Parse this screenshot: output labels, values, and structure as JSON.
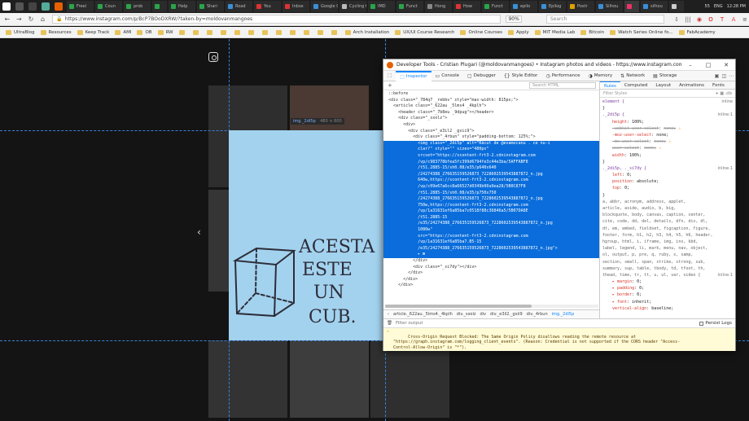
{
  "taskbar": {
    "tabs": [
      "Freel",
      "Coun",
      "prob",
      "",
      "Help",
      "Shari",
      "Road",
      "You",
      "Inbox",
      "Google C",
      "Cycling t",
      "IMD",
      "Funct",
      "Hong",
      "How",
      "Funct",
      "epilo",
      "Epilog",
      "Postr",
      "Silhou",
      "",
      "silhou",
      ""
    ],
    "tray": {
      "lang": "ENG",
      "time": "12:28 PM",
      "battery": "55"
    }
  },
  "browser": {
    "url": "https://www.instagram.com/p/BcP7BOoDXRW/?taken-by=moldovanmangoes",
    "zoom": "90%",
    "search_placeholder": "Search",
    "bookmarks": [
      "UltraBlog",
      "Resources",
      "Keep Track",
      "AMI",
      "OB",
      "RW",
      "",
      "",
      "",
      "",
      "",
      "",
      "",
      "",
      "",
      "",
      "",
      "",
      "Arch Installation",
      "UX/UI Course Research",
      "Online Courses",
      "Apply",
      "MIT Media Lab",
      "Bitcoin",
      "Watch Series Online fo...",
      "FabAcademy"
    ]
  },
  "page": {
    "image_tooltip": {
      "name": "img._2di5p",
      "size": "480 × 600"
    },
    "photo_text": [
      "ACESTA",
      "ESTE",
      "UN",
      "CUB."
    ]
  },
  "devtools": {
    "title": "Developer Tools - Cristian Plugari (@moldovanmangoes) • Instagram photos and videos - https://www.instagram.com/p/BcP7BOoDXR...",
    "tabs": [
      "Inspector",
      "Console",
      "Debugger",
      "Style Editor",
      "Performance",
      "Memory",
      "Network",
      "Storage"
    ],
    "search_html_placeholder": "Search HTML",
    "markup_lines": [
      "  ::before",
      "  <div class=\"_784q7 _rebbv\" style=\"max-width: 815px;\">",
      "    <article class=\"_622au _5lms4 _4kplh\">",
      "      <header class=\"_7b8eu _9dpug\"></header>",
      "      <div class=\"_sxolz\">",
      "        <div>",
      "          <div class=\"_e3il2 _gxii9\">",
      "            <div class=\"_4rbun\" style=\"padding-bottom: 125%;\">",
      "              <img class=\"_2di5p\" alt=\"Răcut de @evamocanu . ce nu-i",
      "              clar?\" style=\"\" sizes=\"480px\"",
      "              srcset=\"https://scontent-frt3-2.cdninstagram.com",
      "              /vp/c983778bfea5fc399d6794fe3c44e3ba/5AFFABF8",
      "              /t51.2885-15/sh0.08/e35/p640x640",
      "              /24274388_276635159526873_7228602539543887872_n.jpg",
      "              640w,https://scontent-frt3-2.cdninstagram.com",
      "              /vp/c09e67a6cc8a66527d0349b00a9ea28/5B0C87F8",
      "              /t51.2885-15/sh0.08/e35/p750x750",
      "              /24274388_276635159526873_7228602539543887872_n.jpg",
      "              750w,https://scontent-frt3-2.cdninstagram.com",
      "              /vp/1a31631ef6a85ba7c0518f88c36846a5/5B07DA8E",
      "              /t51.2885-15",
      "              /e35/24274388_276635159526873_7228602539543887872_n.jpg",
      "              1080w\"",
      "              src=\"https://scontent-frt3-2.cdninstagram.com",
      "              /vp/1a31631ef6a85ba7.B5-15",
      "              /e35/24274388_276635159526873_7228602539543887872_n.jpg\">",
      "              ▸ ⊞",
      "            </div>",
      "            <div class=\"_si7dy\"></div>",
      "          </div>",
      "        </div>",
      "      </div>"
    ],
    "breadcrumb": [
      "article._622au._5lms4._4kplh",
      "div._sxolz",
      "div",
      "div._e3il2._gxii9",
      "div._4rbun",
      "img._2di5p"
    ],
    "rules_tabs": [
      "Rules",
      "Computed",
      "Layout",
      "Animations",
      "Fonts"
    ],
    "filter_styles_placeholder": "Filter Styles",
    "rules_lines": [
      {
        "t": "sel",
        "text": "element {",
        "src": "inline"
      },
      {
        "t": "plain",
        "text": "}"
      },
      {
        "t": "sel",
        "text": "._2di5p {",
        "src": "inline:1"
      },
      {
        "t": "decl",
        "prop": "height",
        "val": "100%;"
      },
      {
        "t": "struck",
        "prop": "-webkit-user-select",
        "val": "none;"
      },
      {
        "t": "decl",
        "prop": "-moz-user-select",
        "val": "none;"
      },
      {
        "t": "struck",
        "prop": "-ms-user-select",
        "val": "none;"
      },
      {
        "t": "struck",
        "prop": "user-select",
        "val": "none;"
      },
      {
        "t": "decl",
        "prop": "width",
        "val": "100%;"
      },
      {
        "t": "plain",
        "text": "}"
      },
      {
        "t": "sel",
        "text": "._2di5p, ._si7dy {",
        "src": "inline:1"
      },
      {
        "t": "decl",
        "prop": "left",
        "val": "0;"
      },
      {
        "t": "decl",
        "prop": "position",
        "val": "absolute;"
      },
      {
        "t": "decl",
        "prop": "top",
        "val": "0;"
      },
      {
        "t": "plain",
        "text": "}"
      },
      {
        "t": "inh",
        "text": "a, abbr, acronym, address, applet,"
      },
      {
        "t": "inh",
        "text": "article, aside, audio, b, big,"
      },
      {
        "t": "inh",
        "text": "blockquote, body, canvas, caption, center,"
      },
      {
        "t": "inh",
        "text": "cite, code, dd, del, details, dfn, div, dl,"
      },
      {
        "t": "inh",
        "text": "dt, em, embed, fieldset, figcaption, figure,"
      },
      {
        "t": "inh",
        "text": "footer, form, h1, h2, h3, h4, h5, h6, header,"
      },
      {
        "t": "inh",
        "text": "hgroup, html, i, iframe, img, ins, kbd,"
      },
      {
        "t": "inh",
        "text": "label, legend, li, mark, menu, nav, object,"
      },
      {
        "t": "inh",
        "text": "ol, output, p, pre, q, ruby, s, samp,"
      },
      {
        "t": "inh",
        "text": "section, small, span, strike, strong, sub,"
      },
      {
        "t": "inh",
        "text": "summary, sup, table, tbody, td, tfoot, th,"
      },
      {
        "t": "inh",
        "text": "thead, time, tr, tt, u, ul, var, video {",
        "src": "inline:1"
      },
      {
        "t": "decl",
        "prop": "▸ margin",
        "val": "0;"
      },
      {
        "t": "decl",
        "prop": "▸ padding",
        "val": "0;"
      },
      {
        "t": "decl",
        "prop": "▸ border",
        "val": "0;"
      },
      {
        "t": "decl",
        "prop": "▸ font",
        "val": "inherit;"
      },
      {
        "t": "decl",
        "prop": "vertical-align",
        "val": "baseline;"
      }
    ],
    "console": {
      "filter_placeholder": "Filter output",
      "persist_logs": "Persist Logs",
      "message": "Cross-Origin Request Blocked: The Same Origin Policy disallows reading the remote resource at\n\"https://graph.instagram.com/logging_client_events\". (Reason: Credential is not supported if the CORS header \"Access-\nControl-Allow-Origin\" is \"*\")."
    }
  }
}
